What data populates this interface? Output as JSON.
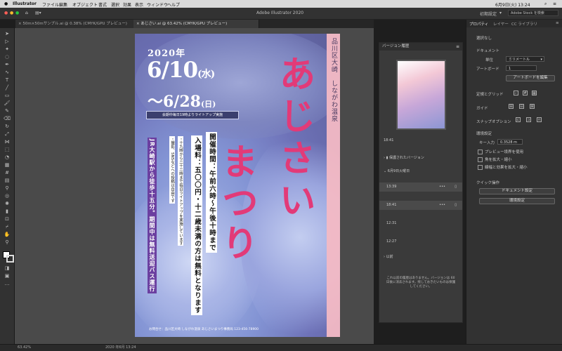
{
  "menubar": {
    "items": [
      "Illustrator",
      "ファイル",
      "編集",
      "オブジェクト",
      "書式",
      "選択",
      "効果",
      "表示",
      "ウィンドウ",
      "ヘルプ"
    ],
    "clock": "6月9日(火) 13:24"
  },
  "titlebar": {
    "title": "Adobe Illustrator 2020",
    "workspace": "初期設定",
    "search_placeholder": "Adobe Stock を検索"
  },
  "tabs": [
    {
      "label": "50m×50mサンプル.ai @ 0.38% (CMYK/GPU プレビュー)"
    },
    {
      "label": "あじさい.ai @ 63.42% (CMYK/GPU プレビュー)"
    }
  ],
  "poster": {
    "year": "2020年",
    "date_start": "6/10",
    "date_start_day": "(水)",
    "date_end": "〜6/28",
    "date_end_day": "(日)",
    "lightup": "会期中毎日19時よりライトアップ実施",
    "place": "品川区大崎　しながわ温泉",
    "title_line1": "あじさい",
    "title_line2": "まつり",
    "hours": "開催時間：午前六時〜午後十時まで",
    "entry": "入場料：五〇〇円・十二歳未満の方は無料となります",
    "note1": "・十九時から二十二時まで毎日ライトアップを実施しています",
    "note2": "・撮影、SNSなどへの投稿は自由です",
    "access": "JR大崎駅から徒歩十五分。期間中は無料送迎バス運行",
    "footer": "お問合せ：品川区大崎 しながわ温泉 あじさいまつり事務局 123-456-78900"
  },
  "version_history": {
    "title": "バージョン履歴",
    "current_time": "18:41",
    "saved_versions": "保護されたバージョン",
    "group_today": "6月9日火曜日",
    "rows": [
      "13:39",
      "18:41",
      "12:31",
      "12:27"
    ],
    "more": "以前",
    "message": "これ以前の履歴はありません。バージョンは 60 日後に消去されます。残しておきたいものは保護してください。"
  },
  "properties": {
    "tabs": [
      "プロパティ",
      "レイヤー",
      "CC ライブラリ"
    ],
    "no_selection": "選択なし",
    "document": "ドキュメント",
    "unit_label": "単位",
    "unit_value": "ミリメートル",
    "artboard_label": "アートボード",
    "artboard_value": "1",
    "edit_artboard": "アートボードを編集",
    "rulers_grids": "定規とグリッド",
    "guides": "ガイド",
    "snap": "スナップオプション",
    "preferences": "環境設定",
    "key_input_label": "キー入力",
    "key_input_value": "0.3528 m",
    "cb1": "プレビュー境界を使用",
    "cb2": "角を拡大・縮小",
    "cb3": "線幅と効果を拡大・縮小",
    "quick_actions": "クイック操作",
    "doc_settings": "ドキュメント設定",
    "prefs_button": "環境設定"
  },
  "status": {
    "zoom": "63.42%",
    "date_info": "2020 年6月 13:24"
  }
}
